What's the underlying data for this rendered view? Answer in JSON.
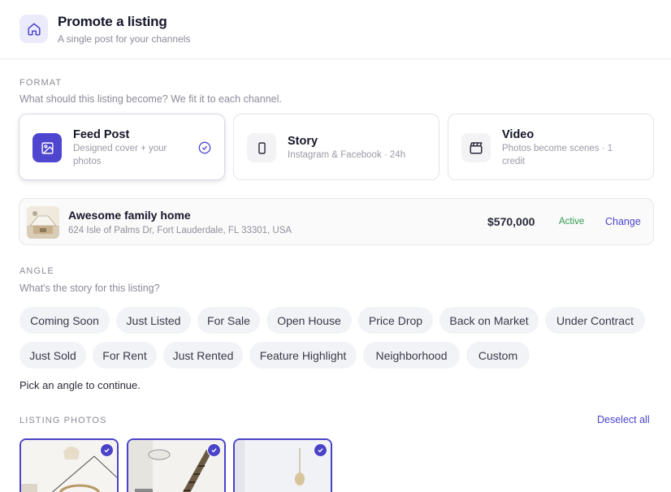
{
  "header": {
    "icon": "home-icon",
    "title": "Promote a listing",
    "subtitle": "A single post for your channels"
  },
  "format": {
    "label": "FORMAT",
    "help": "What should this listing become? We fit it to each channel.",
    "options": [
      {
        "title": "Feed Post",
        "desc_line1": "Designed cover + your",
        "desc_line2": "photos",
        "icon": "image-icon",
        "selected": true
      },
      {
        "title": "Story",
        "desc_line1": "Instagram & Facebook · 24h",
        "desc_line2": "",
        "icon": "phone-icon",
        "selected": false
      },
      {
        "title": "Video",
        "desc_line1": "Photos become scenes · 1",
        "desc_line2": "credit",
        "icon": "clapperboard-icon",
        "selected": false
      }
    ]
  },
  "listing": {
    "title": "Awesome family home",
    "address": "624 Isle of Palms Dr, Fort Lauderdale, FL 33301, USA",
    "price": "$570,000",
    "status": "Active",
    "change_label": "Change"
  },
  "angle": {
    "label": "ANGLE",
    "help": "What's the story for this listing?",
    "chips": [
      "Coming Soon",
      "Just Listed",
      "For Sale",
      "Open House",
      "Price Drop",
      "Back on Market",
      "Under Contract",
      "Just Sold",
      "For Rent",
      "Just Rented",
      "Feature Highlight",
      "Neighborhood",
      "Custom"
    ],
    "hint": "Pick an angle to continue."
  },
  "photos": {
    "label": "LISTING PHOTOS",
    "deselect_label": "Deselect all",
    "selected_count": 3
  },
  "colors": {
    "accent": "#4f46cf",
    "status_green": "#2e9a4e"
  }
}
